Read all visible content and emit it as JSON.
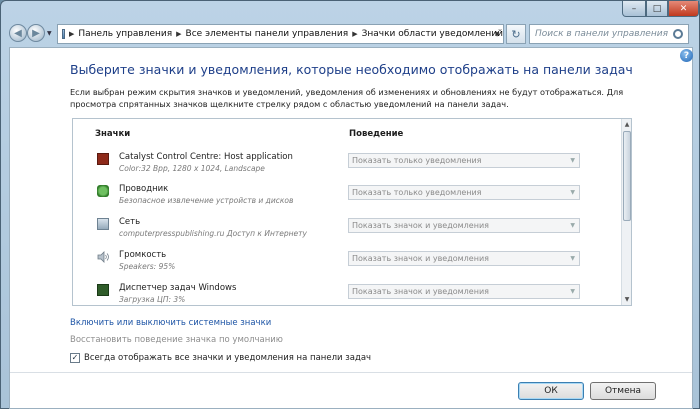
{
  "window": {
    "minimize_glyph": "–",
    "maximize_glyph": "□",
    "close_glyph": "✕"
  },
  "nav": {
    "back_glyph": "◀",
    "forward_glyph": "▶",
    "dropdown_glyph": "▼"
  },
  "address": {
    "separator": "▶",
    "crumbs": [
      "Панель управления",
      "Все элементы панели управления",
      "Значки области уведомлений"
    ],
    "dropdown_glyph": "▼",
    "refresh_glyph": "↻"
  },
  "search": {
    "placeholder": "Поиск в панели управления"
  },
  "help_glyph": "?",
  "page": {
    "title": "Выберите значки и уведомления, которые необходимо отображать на панели задач",
    "description": "Если выбран режим скрытия значков и уведомлений, уведомления об изменениях и обновлениях не будут отображаться. Для просмотра спрятанных значков щелкните стрелку рядом с областью уведомлений на панели задач."
  },
  "table": {
    "header_icons": "Значки",
    "header_behavior": "Поведение",
    "rows": [
      {
        "icon": "ati-icon",
        "name": "Catalyst Control Centre: Host application",
        "sub": "Color:32 Bpp, 1280 x 1024, Landscape",
        "behavior": "Показать только уведомления"
      },
      {
        "icon": "explorer-icon",
        "name": "Проводник",
        "sub": "Безопасное извлечение устройств и дисков",
        "behavior": "Показать только уведомления"
      },
      {
        "icon": "network-icon",
        "name": "Сеть",
        "sub": "computerpresspublishing.ru Доступ к Интернету",
        "behavior": "Показать значок и уведомления"
      },
      {
        "icon": "volume-icon",
        "name": "Громкость",
        "sub": "Speakers: 95%",
        "behavior": "Показать значок и уведомления"
      },
      {
        "icon": "task-manager-icon",
        "name": "Диспетчер задач Windows",
        "sub": "Загрузка ЦП: 3%",
        "behavior": "Показать значок и уведомления"
      }
    ],
    "select_arrow": "▼",
    "scroll_up": "▲",
    "scroll_down": "▼"
  },
  "links": {
    "system_icons": "Включить или выключить системные значки",
    "restore_default": "Восстановить поведение значка по умолчанию"
  },
  "checkbox": {
    "label": "Всегда отображать все значки и уведомления на панели задач",
    "mark": "✓",
    "checked": true
  },
  "buttons": {
    "ok": "ОК",
    "cancel": "Отмена"
  }
}
